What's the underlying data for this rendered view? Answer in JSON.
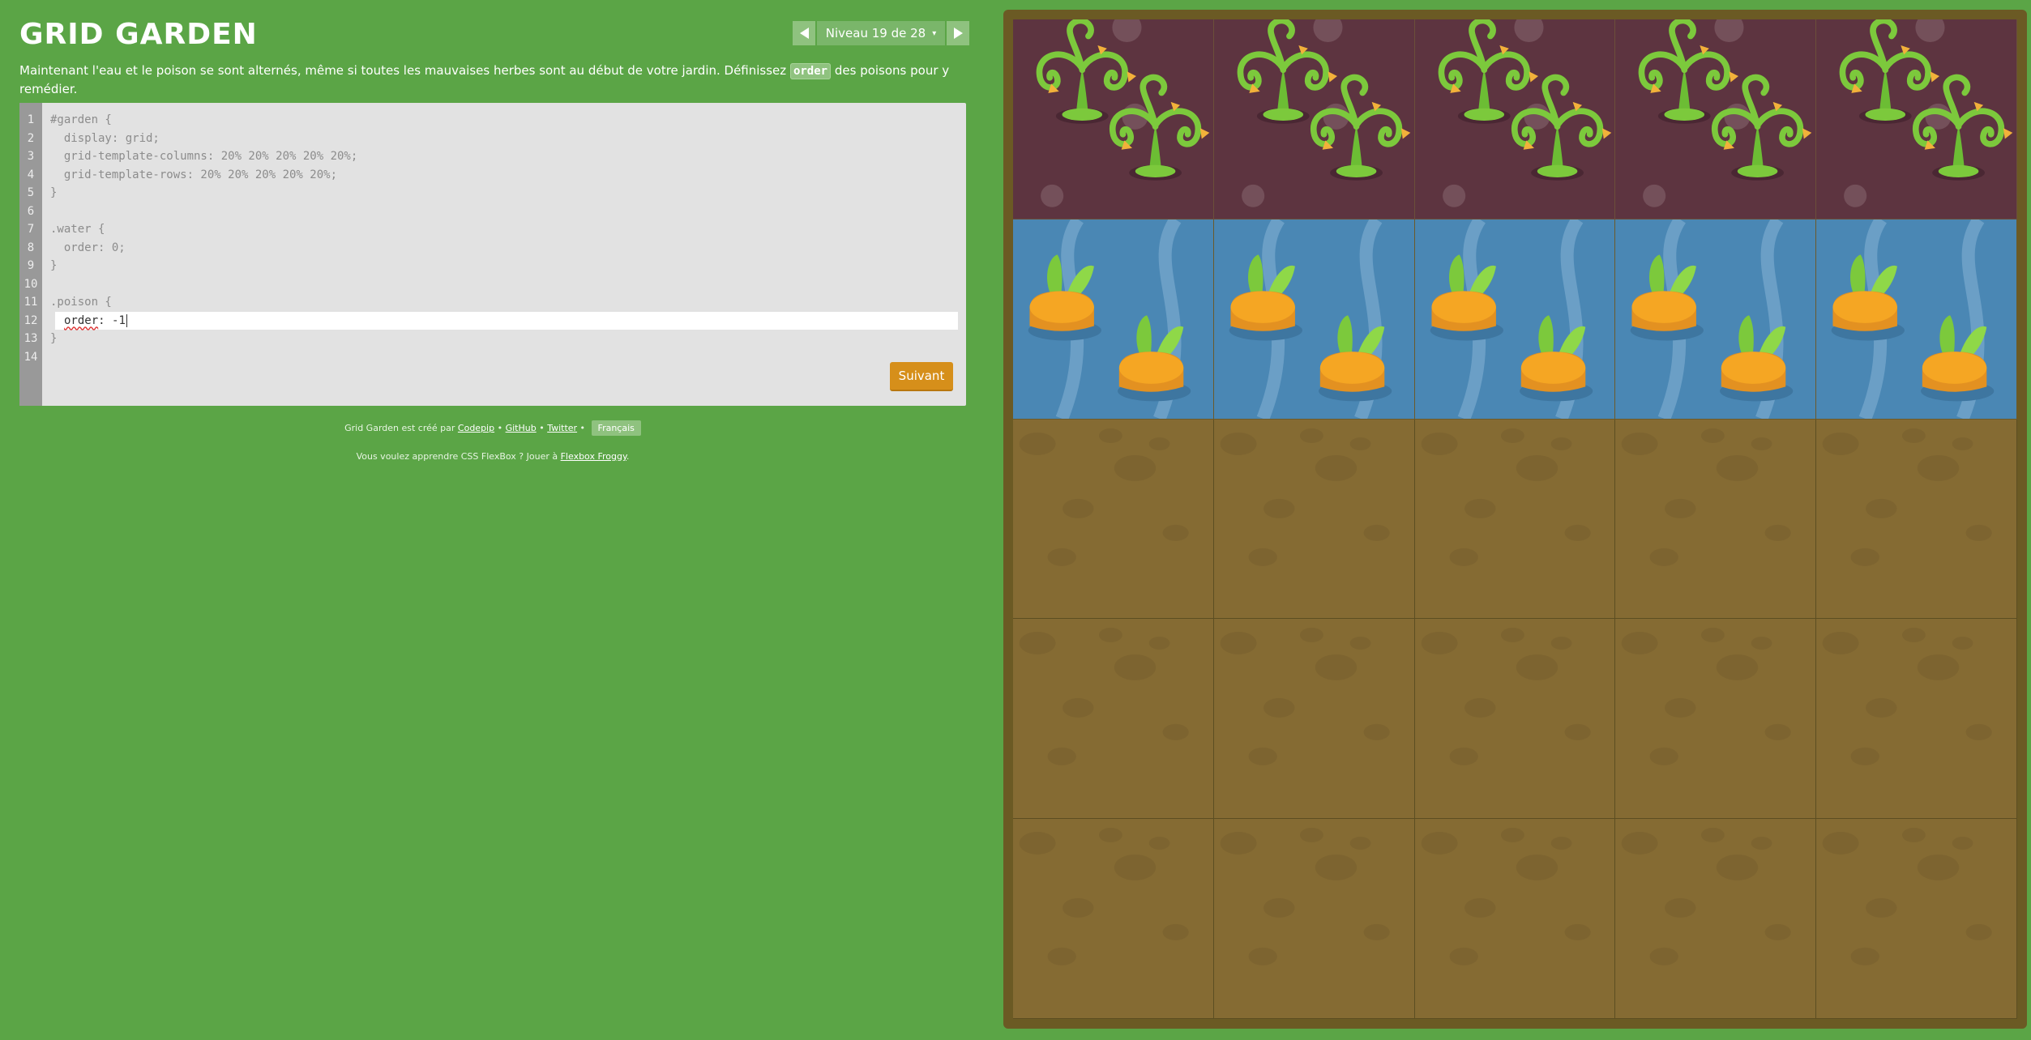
{
  "header": {
    "title": "GRID GARDEN",
    "level_label": "Niveau 19 de 28",
    "level_caret": "▾"
  },
  "instructions": {
    "before": "Maintenant l'eau et le poison se sont alternés, même si toutes les mauvaises herbes sont au début de votre jardin. Définissez ",
    "code": "order",
    "after": " des poisons pour y remédier."
  },
  "editor": {
    "line_numbers": [
      "1",
      "2",
      "3",
      "4",
      "5",
      "6",
      "7",
      "8",
      "9",
      "10",
      "11",
      "12",
      "13",
      "14"
    ],
    "line_1": "#garden {",
    "line_2": "  display: grid;",
    "line_3": "  grid-template-columns: 20% 20% 20% 20% 20%;",
    "line_4": "  grid-template-rows: 20% 20% 20% 20% 20%;",
    "line_5": "}",
    "line_6": "",
    "line_7": ".water {",
    "line_8": "  order: 0;",
    "line_9": "}",
    "line_10": "",
    "line_11": ".poison {",
    "input_word": "order",
    "input_rest": ": -1",
    "line_13": "}",
    "line_14": "",
    "next_label": "Suivant"
  },
  "footer": {
    "credits_prefix": "Grid Garden est créé par ",
    "codepip": "Codepip",
    "sep1": " • ",
    "github": "GitHub",
    "sep2": " • ",
    "twitter": "Twitter",
    "sep3": " • ",
    "language": "Français",
    "promo_prefix": "Vous voulez apprendre CSS FlexBox ? Jouer à ",
    "flexbox_froggy": "Flexbox Froggy",
    "promo_suffix": "."
  },
  "garden": {
    "rows": [
      [
        "poison",
        "poison",
        "poison",
        "poison",
        "poison"
      ],
      [
        "water",
        "water",
        "water",
        "water",
        "water"
      ],
      [
        "soil",
        "soil",
        "soil",
        "soil",
        "soil"
      ],
      [
        "soil",
        "soil",
        "soil",
        "soil",
        "soil"
      ],
      [
        "soil",
        "soil",
        "soil",
        "soil",
        "soil"
      ]
    ],
    "colors": {
      "poison": "#5d3440",
      "water": "#4a87b4",
      "soil": "#856b33",
      "background": "#5ba546",
      "button": "#d68f1a"
    }
  }
}
